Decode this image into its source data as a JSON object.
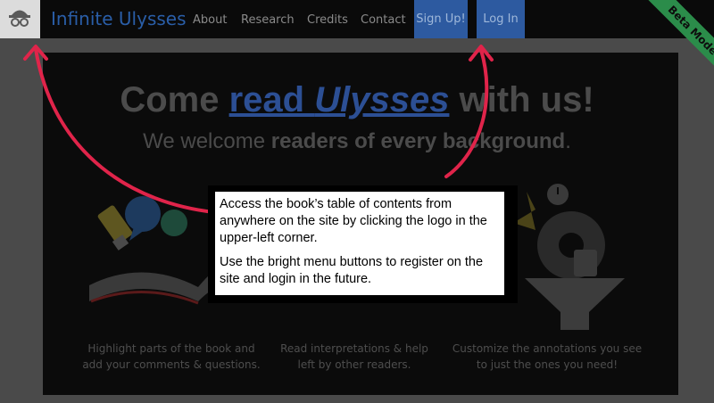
{
  "navbar": {
    "brand": "Infinite Ulysses",
    "links": [
      "About",
      "Research",
      "Credits",
      "Contact"
    ],
    "signup_label": "Sign Up!",
    "login_label": "Log In",
    "beta_label": "Beta Mode!"
  },
  "hero": {
    "title_pre": "Come ",
    "title_link_a": "read ",
    "title_link_b": "Ulysses",
    "title_post": " with us!",
    "subtitle_pre": "We welcome ",
    "subtitle_bold": "readers of every background",
    "subtitle_post": "."
  },
  "features": [
    {
      "line1": "Highlight parts of the book and",
      "line2": "add your comments & questions."
    },
    {
      "line1": "Read interpretations & help",
      "line2": "left by other readers."
    },
    {
      "line1": "Customize the annotations you see",
      "line2": "to just the ones you need!"
    }
  ],
  "callout": {
    "paragraph1": "Access the book’s table of contents from anywhere on the site by clicking the logo in the upper-left corner.",
    "paragraph2": "Use the bright menu buttons to register on the site and login in the future."
  },
  "colors": {
    "annotation_arrow": "#e0244a",
    "brand_blue": "#2a5ea8",
    "button_blue": "#2d5aa0",
    "ribbon_green": "#2b8c4a"
  },
  "icons": [
    "incognito-logo-icon",
    "highlighter-icon",
    "speech-bubbles-icon",
    "open-book-icon",
    "gears-icon",
    "funnel-icon",
    "clock-icon",
    "calculator-icon"
  ]
}
